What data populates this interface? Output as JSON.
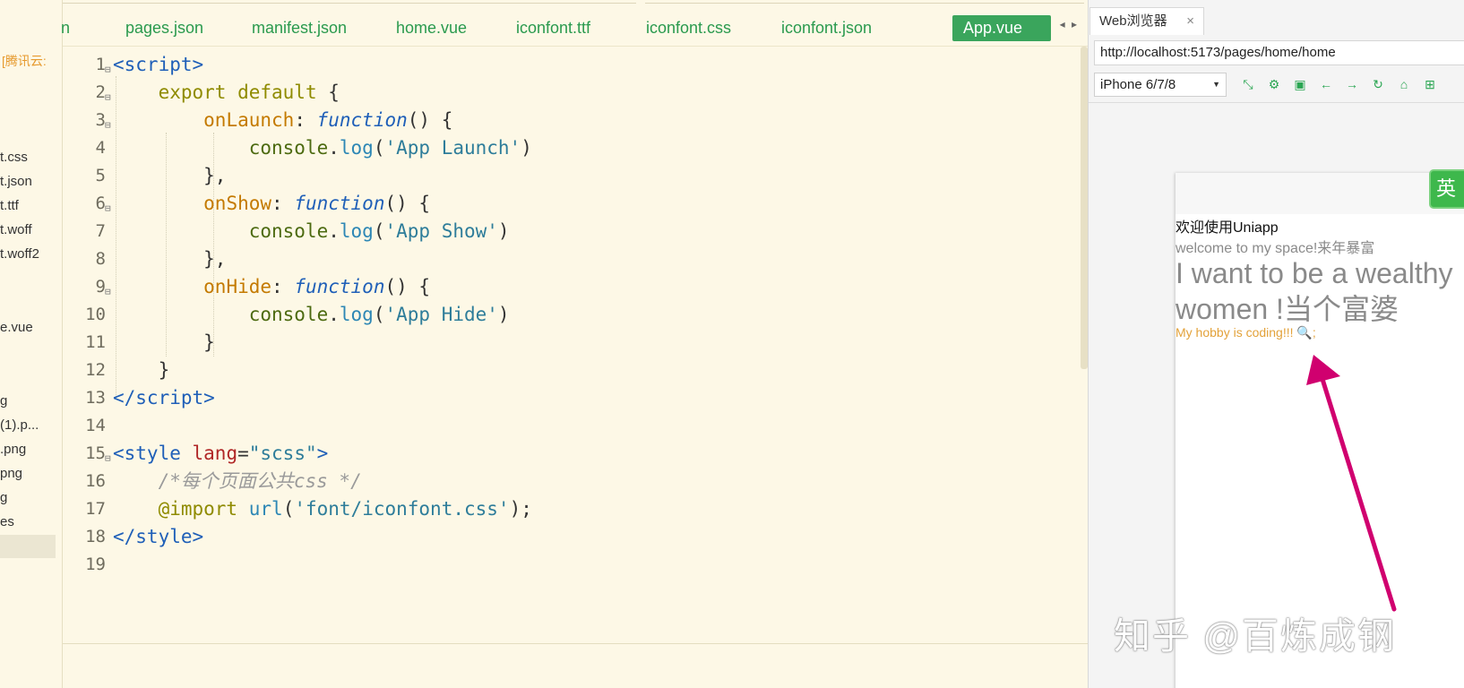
{
  "sidebar": {
    "cloud_label": "[腾讯云:",
    "items": [
      "t.css",
      "t.json",
      "t.ttf",
      "t.woff",
      "t.woff2",
      "e.vue",
      "g",
      "(1).p...",
      ".png",
      "png",
      "g",
      "es"
    ]
  },
  "tabs": [
    {
      "label": "n",
      "active": false
    },
    {
      "label": "pages.json",
      "active": false
    },
    {
      "label": "manifest.json",
      "active": false
    },
    {
      "label": "home.vue",
      "active": false
    },
    {
      "label": "iconfont.ttf",
      "active": false
    },
    {
      "label": "iconfont.css",
      "active": false
    },
    {
      "label": "iconfont.json",
      "active": false
    },
    {
      "label": "App.vue",
      "active": true
    }
  ],
  "tab_arrows": "◂ ▸",
  "code": {
    "line_numbers": [
      "1",
      "2",
      "3",
      "4",
      "5",
      "6",
      "7",
      "8",
      "9",
      "10",
      "11",
      "12",
      "13",
      "14",
      "15",
      "16",
      "17",
      "18",
      "19"
    ],
    "fold_marker": "⊟"
  },
  "browser": {
    "tab_title": "Web浏览器",
    "tab_close": "×",
    "url": "http://localhost:5173/pages/home/home",
    "device": "iPhone 6/7/8",
    "toolbar_icons": [
      "screenshot-icon",
      "settings-icon",
      "console-icon",
      "back-icon",
      "forward-icon",
      "refresh-icon",
      "lock-icon",
      "qrcode-icon"
    ],
    "phone": {
      "ime_label": "英",
      "welcome": "欢迎使用Uniapp",
      "welcome2": "welcome to my space!来年暴富",
      "big_text": "I want to be a wealthy women !当个富婆",
      "hobby": "My hobby is coding!!! 🔍;"
    }
  },
  "watermark": "知乎 @百炼成钢",
  "colors": {
    "accent_green": "#3aa55c",
    "annotation_arrow": "#d0006f",
    "editor_bg": "#fdf8e6"
  }
}
